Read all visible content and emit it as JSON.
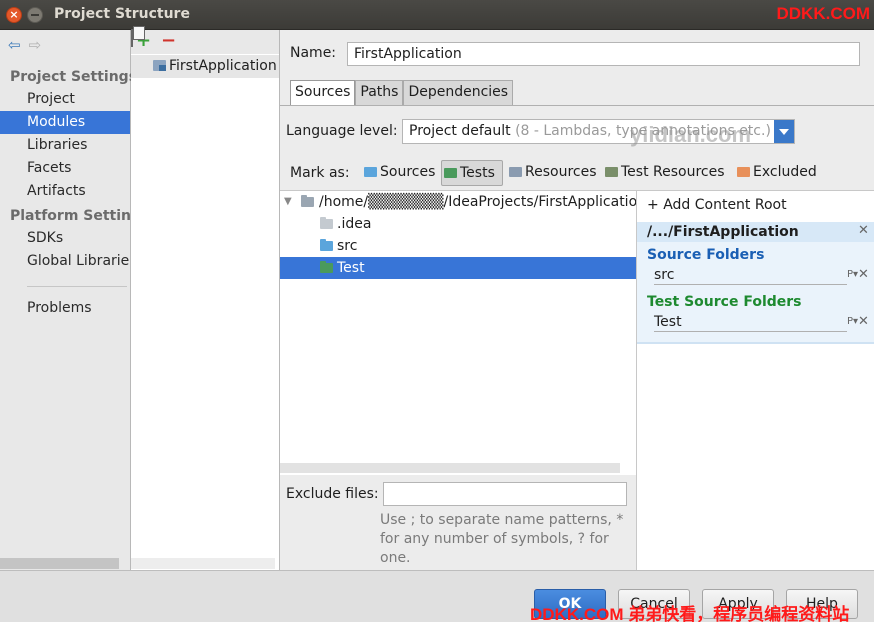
{
  "window": {
    "title": "Project Structure"
  },
  "watermarks": {
    "top": "DDKK.COM",
    "middle": "yiidian.com",
    "bottom": "DDKK.COM 弟弟快看，程序员编程资料站"
  },
  "sidebar": {
    "project_settings_title": "Project Settings",
    "project_items": [
      "Project",
      "Modules",
      "Libraries",
      "Facets",
      "Artifacts"
    ],
    "selected": "Modules",
    "platform_settings_title": "Platform Settings",
    "platform_items": [
      "SDKs",
      "Global Libraries"
    ],
    "problems": "Problems"
  },
  "modules": {
    "items": [
      "FirstApplication"
    ]
  },
  "main": {
    "name_label": "Name:",
    "name_value": "FirstApplication",
    "tabs": [
      "Sources",
      "Paths",
      "Dependencies"
    ],
    "active_tab": "Sources",
    "language_level_label": "Language level:",
    "language_level_value": "Project default",
    "language_level_hint": "(8 - Lambdas, type annotations etc.)",
    "mark_as_label": "Mark as:",
    "mark_buttons": [
      {
        "label": "Sources",
        "color": "#5ba5dc"
      },
      {
        "label": "Tests",
        "color": "#4a9a5c"
      },
      {
        "label": "Resources",
        "color": "#8a9bb0"
      },
      {
        "label": "Test Resources",
        "color": "#7a8f6a"
      },
      {
        "label": "Excluded",
        "color": "#e8905a"
      }
    ],
    "tree": {
      "root": "/home/▒▒▒▒▒▒▒/IdeaProjects/FirstApplication",
      "children": [
        ".idea",
        "src",
        "Test"
      ],
      "selected": "Test"
    },
    "content_root": {
      "add_label": "Add Content Root",
      "path": "/.../FirstApplication",
      "source_folders_title": "Source Folders",
      "source_folders": [
        "src"
      ],
      "test_source_folders_title": "Test Source Folders",
      "test_source_folders": [
        "Test"
      ]
    },
    "exclude_files_label": "Exclude files:",
    "exclude_files_value": "",
    "exclude_help": "Use ; to separate name patterns, * for any number of symbols, ? for one."
  },
  "buttons": {
    "ok": "OK",
    "cancel": "Cancel",
    "apply": "Apply",
    "help": "Help"
  },
  "colors": {
    "selection": "#3875d7",
    "source_title": "#1a5fb4",
    "test_title": "#1e8a30"
  }
}
